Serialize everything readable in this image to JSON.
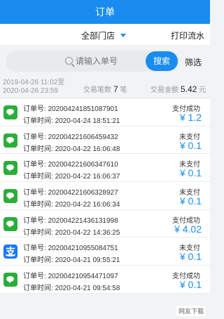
{
  "header": {
    "title": "订单"
  },
  "filter": {
    "store": "全部门店",
    "print": "打印流水"
  },
  "search": {
    "placeholder": "请输入单号",
    "button": "搜索",
    "filter": "筛选"
  },
  "summary": {
    "date_from": "2019-04-26 11:02至",
    "date_to": "2020-04-26 23:59",
    "count_label": "交易笔数",
    "count": "7",
    "count_unit": "笔",
    "amount_label": "交易金额",
    "amount": "5.42",
    "amount_unit": "元"
  },
  "labels": {
    "order_no": "订单号:",
    "order_time": "订单时间:"
  },
  "orders": [
    {
      "method": "wechat",
      "no": "202004241851087901",
      "time": "2020-04-24 18:51:21",
      "status": "支付成功",
      "amount": "¥ 1.2"
    },
    {
      "method": "wechat",
      "no": "202004221606459432",
      "time": "2020-04-22 16:06:48",
      "status": "未支付",
      "amount": "¥ 0.1"
    },
    {
      "method": "wechat",
      "no": "202004221606347610",
      "time": "2020-04-22 16:06:37",
      "status": "未支付",
      "amount": "¥ 0.1"
    },
    {
      "method": "wechat",
      "no": "202004221606328927",
      "time": "2020-04-22 16:06:34",
      "status": "未支付",
      "amount": "¥ 0.1"
    },
    {
      "method": "wechat",
      "no": "202004221436131998",
      "time": "2020-04-22 14:36:25",
      "status": "支付成功",
      "amount": "¥ 4.02"
    },
    {
      "method": "alipay",
      "no": "202004210955084751",
      "time": "2020-04-21 09:55:21",
      "status": "未支付",
      "amount": "¥ 0.1"
    },
    {
      "method": "wechat",
      "no": "202004210954471097",
      "time": "2020-04-21 09:54:58",
      "status": "支付成功",
      "amount": "¥ 0.1"
    }
  ],
  "watermark": "网友下载",
  "colors": {
    "accent": "#1a8cf0",
    "wechat": "#2aae3a",
    "alipay": "#1677ff"
  }
}
